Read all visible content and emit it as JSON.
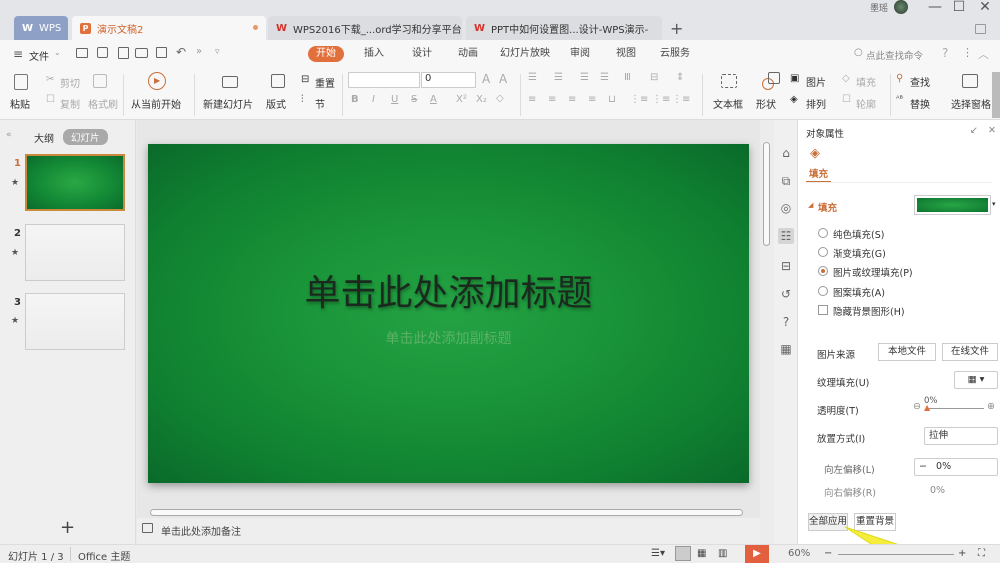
{
  "titlebar": {
    "tabs": [
      {
        "label": "WPS",
        "icon": "wps-logo-icon"
      },
      {
        "label": "演示文稿2",
        "icon": "presentation-icon",
        "modified": true
      },
      {
        "label": "WPS2016下载_...ord学习和分享平台",
        "icon": "wps-w-icon"
      },
      {
        "label": "PPT中如何设置图...设计-WPS演示-",
        "icon": "wps-w-icon"
      }
    ],
    "new_tab": "+",
    "user_name": "墨瑶",
    "minimize": "—",
    "maximize": "☐",
    "close": "✕"
  },
  "menubar": {
    "file_label": "文件",
    "tabs": [
      "开始",
      "插入",
      "设计",
      "动画",
      "幻灯片放映",
      "审阅",
      "视图",
      "云服务"
    ],
    "active_tab": "开始",
    "search_placeholder": "点此查找命令",
    "help": "?"
  },
  "ribbon": {
    "paste": "粘贴",
    "cut": "剪切",
    "copy": "复制",
    "format_painter": "格式刷",
    "from_current": "从当前开始",
    "new_slide": "新建幻灯片",
    "layout": "版式",
    "reset": "重置",
    "section": "节",
    "font_name": "",
    "font_size": "0",
    "textbox": "文本框",
    "shape": "形状",
    "picture": "图片",
    "fill": "填充",
    "arrange": "排列",
    "outline": "轮廓",
    "find": "查找",
    "replace": "替换",
    "selection_pane": "选择窗格"
  },
  "leftpane": {
    "outline_tab": "大纲",
    "slides_tab": "幻灯片",
    "slides": [
      {
        "number": "1",
        "selected": true
      },
      {
        "number": "2",
        "selected": false
      },
      {
        "number": "3",
        "selected": false
      }
    ],
    "add_slide": "+"
  },
  "slide": {
    "title_placeholder": "单击此处添加标题",
    "subtitle_placeholder": "单击此处添加副标题",
    "background_color": "#199338"
  },
  "notes": {
    "placeholder": "单击此处添加备注"
  },
  "properties": {
    "panel_title": "对象属性",
    "tab_fill": "填充",
    "section_fill": "填充",
    "fill_color": "#1a9a3a",
    "options": [
      {
        "label": "纯色填充(S)",
        "selected": false
      },
      {
        "label": "渐变填充(G)",
        "selected": false
      },
      {
        "label": "图片或纹理填充(P)",
        "selected": true
      },
      {
        "label": "图案填充(A)",
        "selected": false
      }
    ],
    "hide_bg_label": "隐藏背景图形(H)",
    "hide_bg_checked": false,
    "picture_source_label": "图片来源",
    "local_file": "本地文件",
    "online_file": "在线文件",
    "texture_fill_label": "纹理填充(U)",
    "transparency_label": "透明度(T)",
    "transparency_value": "0%",
    "placement_label": "放置方式(I)",
    "placement_value": "拉伸",
    "offset_left_label": "向左偏移(L)",
    "offset_left_value": "0%",
    "offset_right_label": "向右偏移(R)",
    "offset_right_value": "0%",
    "apply_all": "全部应用",
    "reset_bg": "重置背景"
  },
  "statusbar": {
    "slide_count": "幻灯片 1 / 3",
    "theme": "Office 主题",
    "zoom": "60%"
  }
}
